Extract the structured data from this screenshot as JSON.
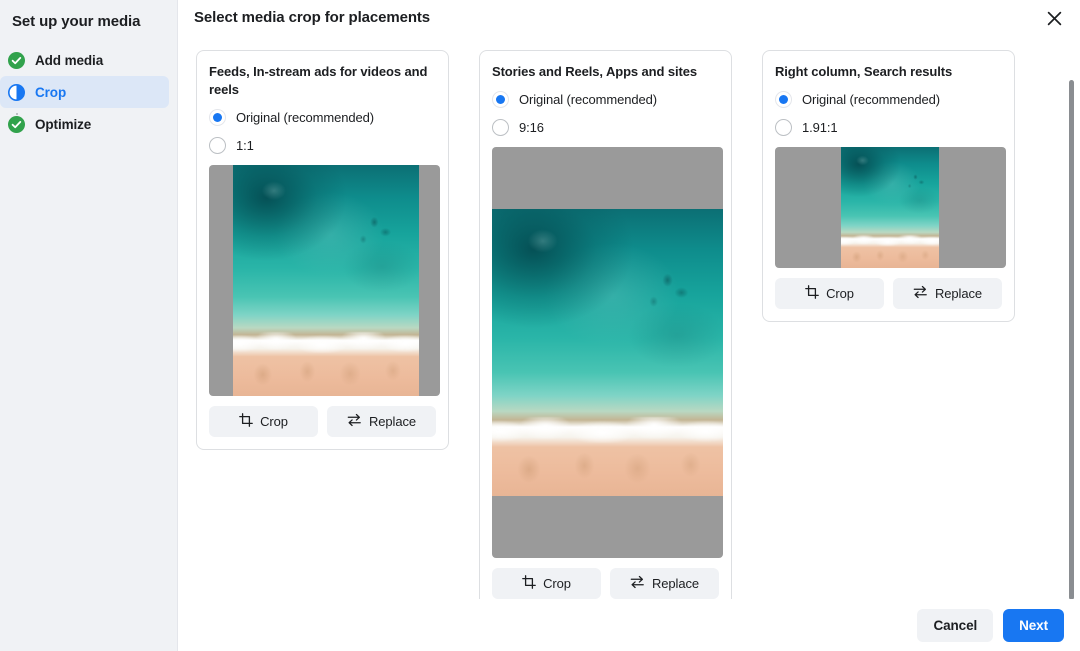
{
  "sidebar": {
    "title": "Set up your media",
    "items": [
      {
        "label": "Add media",
        "state": "complete",
        "icon": "check-circle-icon"
      },
      {
        "label": "Crop",
        "state": "active",
        "icon": "half-circle-icon"
      },
      {
        "label": "Optimize",
        "state": "complete",
        "icon": "check-circle-icon"
      }
    ]
  },
  "header": {
    "title": "Select media crop for placements",
    "close_icon": "close-icon"
  },
  "cards": [
    {
      "title": "Feeds, In-stream ads for videos and reels",
      "options": [
        {
          "label": "Original (recommended)",
          "selected": true
        },
        {
          "label": "1:1",
          "selected": false
        }
      ],
      "preview": {
        "aspect": "1:1",
        "letterbox": "pillarbox"
      },
      "actions": [
        {
          "label": "Crop",
          "icon": "crop-icon"
        },
        {
          "label": "Replace",
          "icon": "swap-icon"
        }
      ]
    },
    {
      "title": "Stories and Reels, Apps and sites",
      "options": [
        {
          "label": "Original (recommended)",
          "selected": true
        },
        {
          "label": "9:16",
          "selected": false
        }
      ],
      "preview": {
        "aspect": "9:16",
        "letterbox": "letterbox"
      },
      "actions": [
        {
          "label": "Crop",
          "icon": "crop-icon"
        },
        {
          "label": "Replace",
          "icon": "swap-icon"
        }
      ]
    },
    {
      "title": "Right column, Search results",
      "options": [
        {
          "label": "Original (recommended)",
          "selected": true
        },
        {
          "label": "1.91:1",
          "selected": false
        }
      ],
      "preview": {
        "aspect": "1.91:1",
        "letterbox": "pillarbox"
      },
      "actions": [
        {
          "label": "Crop",
          "icon": "crop-icon"
        },
        {
          "label": "Replace",
          "icon": "swap-icon"
        }
      ]
    }
  ],
  "footer": {
    "cancel_label": "Cancel",
    "next_label": "Next"
  },
  "colors": {
    "accent": "#1877f2",
    "complete": "#31a24c",
    "sidebar_bg": "#f0f2f5",
    "active_step_bg": "#dce7f7",
    "letterbox_gray": "#9a9a9a"
  }
}
